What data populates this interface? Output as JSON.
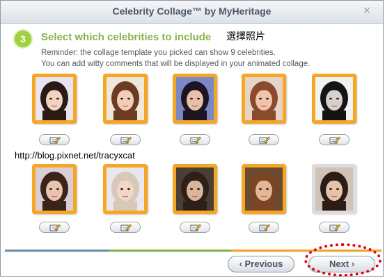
{
  "window": {
    "title": "Celebrity Collage™ by MyHeritage",
    "close_glyph": "×"
  },
  "step": {
    "number": "3",
    "heading": "Select which celebrities to include",
    "heading_annotation": "選擇照片",
    "reminder_line1": "Reminder: the collage template you picked can show 9 celebrities.",
    "reminder_line2": "You can add witty comments that will be displayed in your animated collage."
  },
  "celebrities": [
    {
      "selected": true,
      "palette": {
        "bg": "#e9e4ef",
        "hair": "#2a1a14",
        "skin": "#f2d2c0"
      }
    },
    {
      "selected": true,
      "palette": {
        "bg": "#efe6dc",
        "hair": "#6b3b22",
        "skin": "#f3cdb6"
      }
    },
    {
      "selected": true,
      "palette": {
        "bg": "#7a89c6",
        "hair": "#1c1420",
        "skin": "#e8c0aa"
      }
    },
    {
      "selected": true,
      "palette": {
        "bg": "#e7d4c9",
        "hair": "#8a4a2c",
        "skin": "#f1c4ad"
      }
    },
    {
      "selected": true,
      "palette": {
        "bg": "#f2f2f2",
        "hair": "#141414",
        "skin": "#d8d0cc"
      }
    },
    {
      "selected": true,
      "palette": {
        "bg": "#d9cdd6",
        "hair": "#3a2318",
        "skin": "#eac3ae"
      }
    },
    {
      "selected": true,
      "palette": {
        "bg": "#e8e6ee",
        "hair": "#d7c8b8",
        "skin": "#f2d6c8"
      }
    },
    {
      "selected": true,
      "palette": {
        "bg": "#4a3e36",
        "hair": "#2e2018",
        "skin": "#d8b59c"
      }
    },
    {
      "selected": true,
      "palette": {
        "bg": "#6a4a30",
        "hair": "#7a4524",
        "skin": "#e4b896"
      }
    },
    {
      "selected": false,
      "palette": {
        "bg": "#cfc3b8",
        "hair": "#2b1d16",
        "skin": "#e6c3ab"
      }
    }
  ],
  "watermark": "http://blog.pixnet.net/tracyxcat",
  "navigation": {
    "previous_label": "‹ Previous",
    "next_label": "Next ›"
  },
  "colors": {
    "accent_green": "#86b34c",
    "frame_orange": "#f5a623",
    "highlight_red": "#e0001a",
    "progress": [
      "#6f8fa8",
      "#86b34c",
      "#f5a623"
    ]
  }
}
